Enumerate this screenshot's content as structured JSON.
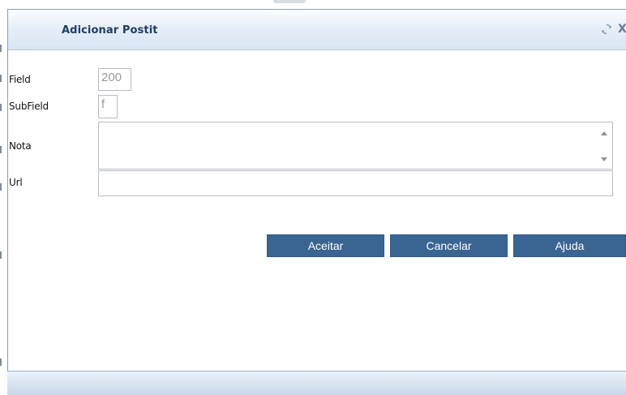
{
  "dialog": {
    "title": "Adicionar Postit",
    "refresh_icon": "refresh-icon",
    "close_label": "X"
  },
  "form": {
    "field": {
      "label": "Field",
      "value": "200"
    },
    "subfield": {
      "label": "SubField",
      "value": "f"
    },
    "nota": {
      "label": "Nota",
      "value": ""
    },
    "url": {
      "label": "Url",
      "value": ""
    }
  },
  "buttons": {
    "accept": "Aceitar",
    "cancel": "Cancelar",
    "help": "Ajuda"
  },
  "colors": {
    "title_text": "#1f3c64",
    "button_bg": "#3a6592",
    "titlebar_bg": "#d9e5f3"
  }
}
